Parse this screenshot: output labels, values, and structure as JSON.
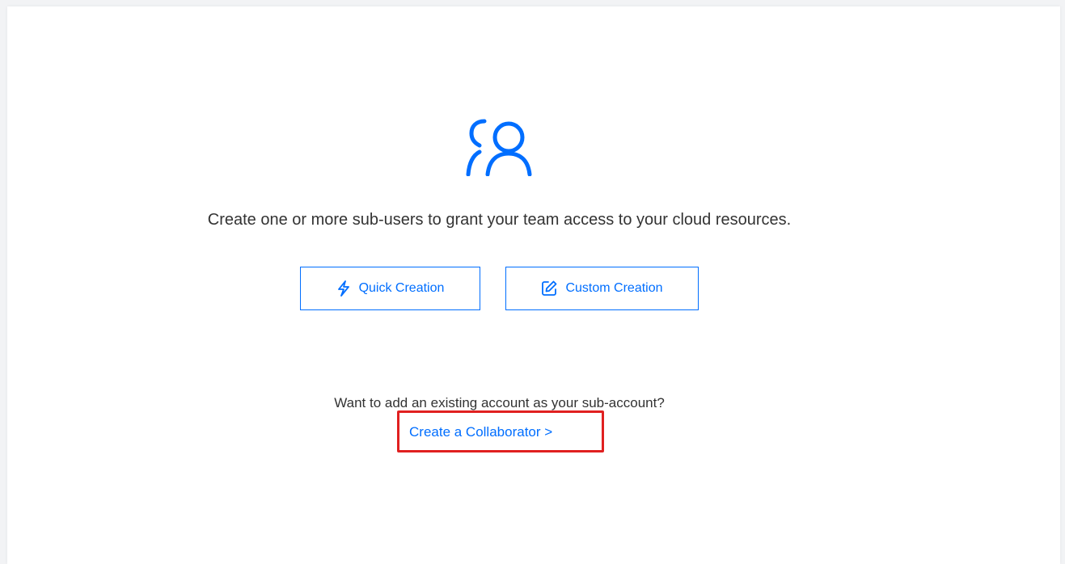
{
  "empty_state": {
    "icon": "users-icon",
    "message": "Create one or more sub-users to grant your team access to your cloud resources.",
    "buttons": {
      "quick_creation": {
        "label": "Quick Creation",
        "icon": "lightning-icon"
      },
      "custom_creation": {
        "label": "Custom Creation",
        "icon": "edit-icon"
      }
    },
    "collaborator": {
      "question": "Want to add an existing account as your sub-account?",
      "link_label": "Create a Collaborator >"
    }
  },
  "annotation": {
    "highlight_color": "#e02020"
  },
  "colors": {
    "accent": "#006eff",
    "text": "#333333",
    "background": "#ffffff"
  }
}
